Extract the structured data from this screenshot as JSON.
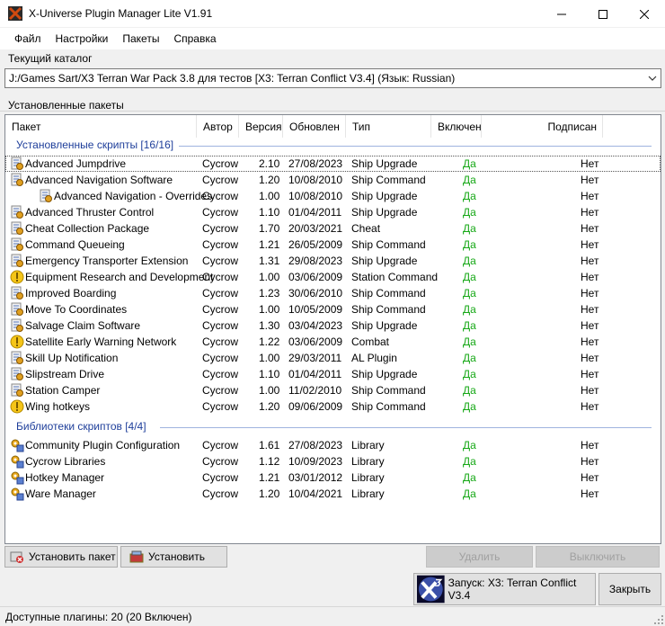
{
  "window": {
    "title": "X-Universe Plugin Manager Lite V1.91",
    "minimize_glyph": "—",
    "maximize_glyph": "☐",
    "close_glyph": "✕"
  },
  "menu": [
    "Файл",
    "Настройки",
    "Пакеты",
    "Справка"
  ],
  "catalog": {
    "label": "Текущий каталог",
    "value": "J:/Games Sart/X3 Terran War Pack 3.8 для тестов [X3: Terran Conflict V3.4] (Язык: Russian)"
  },
  "installed_label": "Установленные пакеты",
  "columns": [
    "Пакет",
    "Автор",
    "Версия",
    "Обновлен",
    "Тип",
    "Включен",
    "Подписан"
  ],
  "groups": [
    {
      "title": "Установленные скрипты [16/16]",
      "rows": [
        {
          "icon": "script-icon",
          "indent": 0,
          "name": "Advanced Jumpdrive",
          "author": "Cycrow",
          "version": "2.10",
          "updated": "27/08/2023",
          "type": "Ship Upgrade",
          "enabled": "Да",
          "signed": "Нет"
        },
        {
          "icon": "script-icon",
          "indent": 0,
          "name": "Advanced Navigation Software",
          "author": "Cycrow",
          "version": "1.20",
          "updated": "10/08/2010",
          "type": "Ship Command",
          "enabled": "Да",
          "signed": "Нет"
        },
        {
          "icon": "script-icon",
          "indent": 1,
          "name": "Advanced Navigation - Overrides",
          "author": "Cycrow",
          "version": "1.00",
          "updated": "10/08/2010",
          "type": "Ship Upgrade",
          "enabled": "Да",
          "signed": "Нет"
        },
        {
          "icon": "script-icon",
          "indent": 0,
          "name": "Advanced Thruster Control",
          "author": "Cycrow",
          "version": "1.10",
          "updated": "01/04/2011",
          "type": "Ship Upgrade",
          "enabled": "Да",
          "signed": "Нет"
        },
        {
          "icon": "script-icon",
          "indent": 0,
          "name": "Cheat Collection Package",
          "author": "Cycrow",
          "version": "1.70",
          "updated": "20/03/2021",
          "type": "Cheat",
          "enabled": "Да",
          "signed": "Нет"
        },
        {
          "icon": "script-icon",
          "indent": 0,
          "name": "Command Queueing",
          "author": "Cycrow",
          "version": "1.21",
          "updated": "26/05/2009",
          "type": "Ship Command",
          "enabled": "Да",
          "signed": "Нет"
        },
        {
          "icon": "script-icon",
          "indent": 0,
          "name": "Emergency Transporter Extension",
          "author": "Cycrow",
          "version": "1.31",
          "updated": "29/08/2023",
          "type": "Ship Upgrade",
          "enabled": "Да",
          "signed": "Нет"
        },
        {
          "icon": "warning-icon",
          "indent": 0,
          "name": "Equipment Research and Development",
          "author": "Cycrow",
          "version": "1.00",
          "updated": "03/06/2009",
          "type": "Station Command",
          "enabled": "Да",
          "signed": "Нет"
        },
        {
          "icon": "script-icon",
          "indent": 0,
          "name": "Improved Boarding",
          "author": "Cycrow",
          "version": "1.23",
          "updated": "30/06/2010",
          "type": "Ship Command",
          "enabled": "Да",
          "signed": "Нет"
        },
        {
          "icon": "script-icon",
          "indent": 0,
          "name": "Move To Coordinates",
          "author": "Cycrow",
          "version": "1.00",
          "updated": "10/05/2009",
          "type": "Ship Command",
          "enabled": "Да",
          "signed": "Нет"
        },
        {
          "icon": "script-icon",
          "indent": 0,
          "name": "Salvage Claim Software",
          "author": "Cycrow",
          "version": "1.30",
          "updated": "03/04/2023",
          "type": "Ship Upgrade",
          "enabled": "Да",
          "signed": "Нет"
        },
        {
          "icon": "warning-icon",
          "indent": 0,
          "name": "Satellite Early Warning Network",
          "author": "Cycrow",
          "version": "1.22",
          "updated": "03/06/2009",
          "type": "Combat",
          "enabled": "Да",
          "signed": "Нет"
        },
        {
          "icon": "script-icon",
          "indent": 0,
          "name": "Skill Up Notification",
          "author": "Cycrow",
          "version": "1.00",
          "updated": "29/03/2011",
          "type": "AL Plugin",
          "enabled": "Да",
          "signed": "Нет"
        },
        {
          "icon": "script-icon",
          "indent": 0,
          "name": "Slipstream Drive",
          "author": "Cycrow",
          "version": "1.10",
          "updated": "01/04/2011",
          "type": "Ship Upgrade",
          "enabled": "Да",
          "signed": "Нет"
        },
        {
          "icon": "script-icon",
          "indent": 0,
          "name": "Station Camper",
          "author": "Cycrow",
          "version": "1.00",
          "updated": "11/02/2010",
          "type": "Ship Command",
          "enabled": "Да",
          "signed": "Нет"
        },
        {
          "icon": "warning-icon",
          "indent": 0,
          "name": "Wing hotkeys",
          "author": "Cycrow",
          "version": "1.20",
          "updated": "09/06/2009",
          "type": "Ship Command",
          "enabled": "Да",
          "signed": "Нет"
        }
      ]
    },
    {
      "title": "Библиотеки скриптов [4/4]",
      "rows": [
        {
          "icon": "library-icon",
          "indent": 0,
          "name": "Community Plugin Configuration",
          "author": "Cycrow",
          "version": "1.61",
          "updated": "27/08/2023",
          "type": "Library",
          "enabled": "Да",
          "signed": "Нет"
        },
        {
          "icon": "library-icon",
          "indent": 0,
          "name": "Cycrow Libraries",
          "author": "Cycrow",
          "version": "1.12",
          "updated": "10/09/2023",
          "type": "Library",
          "enabled": "Да",
          "signed": "Нет"
        },
        {
          "icon": "library-icon",
          "indent": 0,
          "name": "Hotkey Manager",
          "author": "Cycrow",
          "version": "1.21",
          "updated": "03/01/2012",
          "type": "Library",
          "enabled": "Да",
          "signed": "Нет"
        },
        {
          "icon": "library-icon",
          "indent": 0,
          "name": "Ware Manager",
          "author": "Cycrow",
          "version": "1.20",
          "updated": "10/04/2021",
          "type": "Library",
          "enabled": "Да",
          "signed": "Нет"
        }
      ]
    }
  ],
  "buttons": {
    "install_package": "Установить пакет",
    "install": "Установить",
    "remove": "Удалить",
    "disable": "Выключить",
    "launch": "Запуск: X3: Terran Conflict V3.4",
    "close": "Закрыть"
  },
  "status": "Доступные плагины: 20 (20 Включен)",
  "colors": {
    "group_header": "#1e3e9a",
    "enabled_text": "#16a816"
  }
}
